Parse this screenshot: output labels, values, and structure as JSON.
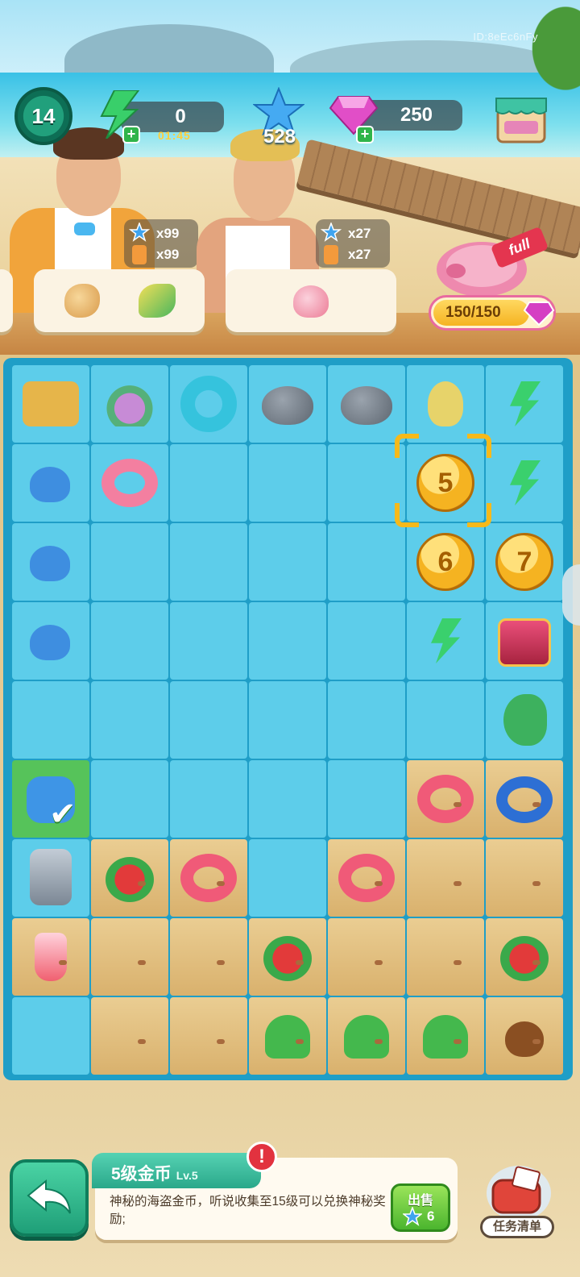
{
  "hud": {
    "level": "14",
    "energy": "0",
    "energy_timer": "01:45",
    "stars": "528",
    "gems": "250",
    "player_id": "ID:8eEc6nFy"
  },
  "orders": [
    {
      "star_count": "x99",
      "drink_count": "x99"
    },
    {
      "star_count": "x27",
      "drink_count": "x27"
    }
  ],
  "piggy_bank": {
    "progress": "150/150",
    "tag": "full"
  },
  "board": {
    "rows": [
      [
        "cart",
        "shell-pile",
        "donut-blue",
        "rock",
        "rock",
        "bird",
        "energy"
      ],
      [
        "scoop",
        "ring-pink",
        "empty",
        "empty",
        "empty",
        "coin-5",
        "energy"
      ],
      [
        "scoop",
        "empty",
        "empty",
        "empty",
        "empty",
        "coin-6",
        "coin-7"
      ],
      [
        "scoop",
        "empty",
        "empty",
        "empty",
        "empty",
        "energy",
        "chest"
      ],
      [
        "empty",
        "empty",
        "empty",
        "empty",
        "empty",
        "empty",
        "parrot"
      ],
      [
        "can",
        "empty",
        "empty",
        "empty",
        "empty",
        "lifebuoy",
        "whale-ring"
      ],
      [
        "machine",
        "drink-bowl",
        "lifebuoy",
        "empty",
        "lifebuoy",
        "sand",
        "sand"
      ],
      [
        "drink",
        "sand",
        "sand",
        "watermelon",
        "sand",
        "sand",
        "melon-slices"
      ],
      [
        "empty",
        "sand",
        "sand",
        "flowers",
        "plant",
        "sprout",
        "seed"
      ]
    ],
    "coin_labels": {
      "coin-5": "5",
      "coin-6": "6",
      "coin-7": "7"
    }
  },
  "info": {
    "title": "5级金币",
    "level": "Lv.5",
    "alert": "!",
    "description": "神秘的海盗金币，听说收集至15级可以兑换神秘奖励;",
    "sell_label": "出售",
    "sell_value": "6"
  },
  "task_button": {
    "label": "任务清单"
  },
  "colors": {
    "board": "#1f9ec7",
    "cell": "#5dcdea",
    "accent_green": "#2aa88a",
    "coin": "#f5b321"
  }
}
